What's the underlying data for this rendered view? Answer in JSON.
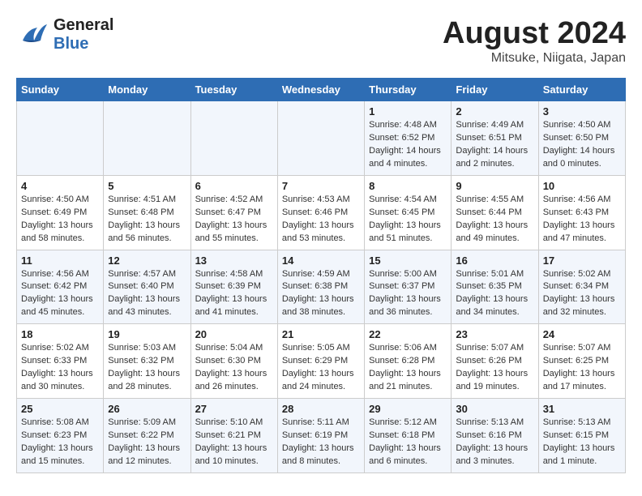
{
  "header": {
    "logo_general": "General",
    "logo_blue": "Blue",
    "title": "August 2024",
    "subtitle": "Mitsuke, Niigata, Japan"
  },
  "calendar": {
    "days_of_week": [
      "Sunday",
      "Monday",
      "Tuesday",
      "Wednesday",
      "Thursday",
      "Friday",
      "Saturday"
    ],
    "weeks": [
      [
        {
          "day": "",
          "info": ""
        },
        {
          "day": "",
          "info": ""
        },
        {
          "day": "",
          "info": ""
        },
        {
          "day": "",
          "info": ""
        },
        {
          "day": "1",
          "info": "Sunrise: 4:48 AM\nSunset: 6:52 PM\nDaylight: 14 hours\nand 4 minutes."
        },
        {
          "day": "2",
          "info": "Sunrise: 4:49 AM\nSunset: 6:51 PM\nDaylight: 14 hours\nand 2 minutes."
        },
        {
          "day": "3",
          "info": "Sunrise: 4:50 AM\nSunset: 6:50 PM\nDaylight: 14 hours\nand 0 minutes."
        }
      ],
      [
        {
          "day": "4",
          "info": "Sunrise: 4:50 AM\nSunset: 6:49 PM\nDaylight: 13 hours\nand 58 minutes."
        },
        {
          "day": "5",
          "info": "Sunrise: 4:51 AM\nSunset: 6:48 PM\nDaylight: 13 hours\nand 56 minutes."
        },
        {
          "day": "6",
          "info": "Sunrise: 4:52 AM\nSunset: 6:47 PM\nDaylight: 13 hours\nand 55 minutes."
        },
        {
          "day": "7",
          "info": "Sunrise: 4:53 AM\nSunset: 6:46 PM\nDaylight: 13 hours\nand 53 minutes."
        },
        {
          "day": "8",
          "info": "Sunrise: 4:54 AM\nSunset: 6:45 PM\nDaylight: 13 hours\nand 51 minutes."
        },
        {
          "day": "9",
          "info": "Sunrise: 4:55 AM\nSunset: 6:44 PM\nDaylight: 13 hours\nand 49 minutes."
        },
        {
          "day": "10",
          "info": "Sunrise: 4:56 AM\nSunset: 6:43 PM\nDaylight: 13 hours\nand 47 minutes."
        }
      ],
      [
        {
          "day": "11",
          "info": "Sunrise: 4:56 AM\nSunset: 6:42 PM\nDaylight: 13 hours\nand 45 minutes."
        },
        {
          "day": "12",
          "info": "Sunrise: 4:57 AM\nSunset: 6:40 PM\nDaylight: 13 hours\nand 43 minutes."
        },
        {
          "day": "13",
          "info": "Sunrise: 4:58 AM\nSunset: 6:39 PM\nDaylight: 13 hours\nand 41 minutes."
        },
        {
          "day": "14",
          "info": "Sunrise: 4:59 AM\nSunset: 6:38 PM\nDaylight: 13 hours\nand 38 minutes."
        },
        {
          "day": "15",
          "info": "Sunrise: 5:00 AM\nSunset: 6:37 PM\nDaylight: 13 hours\nand 36 minutes."
        },
        {
          "day": "16",
          "info": "Sunrise: 5:01 AM\nSunset: 6:35 PM\nDaylight: 13 hours\nand 34 minutes."
        },
        {
          "day": "17",
          "info": "Sunrise: 5:02 AM\nSunset: 6:34 PM\nDaylight: 13 hours\nand 32 minutes."
        }
      ],
      [
        {
          "day": "18",
          "info": "Sunrise: 5:02 AM\nSunset: 6:33 PM\nDaylight: 13 hours\nand 30 minutes."
        },
        {
          "day": "19",
          "info": "Sunrise: 5:03 AM\nSunset: 6:32 PM\nDaylight: 13 hours\nand 28 minutes."
        },
        {
          "day": "20",
          "info": "Sunrise: 5:04 AM\nSunset: 6:30 PM\nDaylight: 13 hours\nand 26 minutes."
        },
        {
          "day": "21",
          "info": "Sunrise: 5:05 AM\nSunset: 6:29 PM\nDaylight: 13 hours\nand 24 minutes."
        },
        {
          "day": "22",
          "info": "Sunrise: 5:06 AM\nSunset: 6:28 PM\nDaylight: 13 hours\nand 21 minutes."
        },
        {
          "day": "23",
          "info": "Sunrise: 5:07 AM\nSunset: 6:26 PM\nDaylight: 13 hours\nand 19 minutes."
        },
        {
          "day": "24",
          "info": "Sunrise: 5:07 AM\nSunset: 6:25 PM\nDaylight: 13 hours\nand 17 minutes."
        }
      ],
      [
        {
          "day": "25",
          "info": "Sunrise: 5:08 AM\nSunset: 6:23 PM\nDaylight: 13 hours\nand 15 minutes."
        },
        {
          "day": "26",
          "info": "Sunrise: 5:09 AM\nSunset: 6:22 PM\nDaylight: 13 hours\nand 12 minutes."
        },
        {
          "day": "27",
          "info": "Sunrise: 5:10 AM\nSunset: 6:21 PM\nDaylight: 13 hours\nand 10 minutes."
        },
        {
          "day": "28",
          "info": "Sunrise: 5:11 AM\nSunset: 6:19 PM\nDaylight: 13 hours\nand 8 minutes."
        },
        {
          "day": "29",
          "info": "Sunrise: 5:12 AM\nSunset: 6:18 PM\nDaylight: 13 hours\nand 6 minutes."
        },
        {
          "day": "30",
          "info": "Sunrise: 5:13 AM\nSunset: 6:16 PM\nDaylight: 13 hours\nand 3 minutes."
        },
        {
          "day": "31",
          "info": "Sunrise: 5:13 AM\nSunset: 6:15 PM\nDaylight: 13 hours\nand 1 minute."
        }
      ]
    ]
  }
}
